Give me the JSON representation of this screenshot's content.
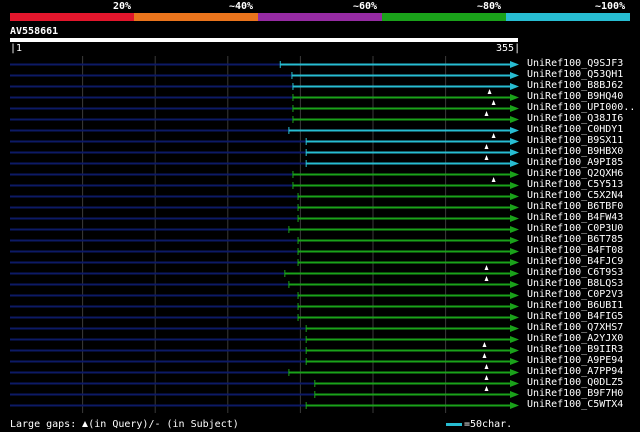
{
  "legend": {
    "labels": [
      "20%",
      "~40%",
      "~60%",
      "~80%",
      "~100%"
    ],
    "colors": [
      "#e2162c",
      "#ea741c",
      "#962ba3",
      "#1aa21a",
      "#27bdd2"
    ]
  },
  "query": {
    "name": "AV558661",
    "start": "1",
    "end": "355"
  },
  "colors": {
    "cyan": "#27bdd2",
    "green": "#1aa21a",
    "navy": "#0d1a66",
    "grid": "#3a3a3a"
  },
  "footer": {
    "text_before": "Large gaps: ",
    "text_after": "(in Query)/- (in Subject)",
    "scale_label": "=50char."
  },
  "hits": [
    {
      "name": "UniRef100_Q9SJF3",
      "start": 0.532,
      "color": "cyan",
      "gap": null
    },
    {
      "name": "UniRef100_Q53QH1",
      "start": 0.555,
      "color": "cyan",
      "gap": null
    },
    {
      "name": "UniRef100_B8BJ62",
      "start": 0.557,
      "color": "cyan",
      "gap": null
    },
    {
      "name": "UniRef100_B9HQ40",
      "start": 0.557,
      "color": "green",
      "gap": 0.944
    },
    {
      "name": "UniRef100_UPI000..",
      "start": 0.557,
      "color": "green",
      "gap": 0.952
    },
    {
      "name": "UniRef100_Q38JI6",
      "start": 0.557,
      "color": "green",
      "gap": 0.938
    },
    {
      "name": "UniRef100_C0HDY1",
      "start": 0.549,
      "color": "cyan",
      "gap": null
    },
    {
      "name": "UniRef100_B9SX11",
      "start": 0.583,
      "color": "cyan",
      "gap": 0.952
    },
    {
      "name": "UniRef100_B9HBX0",
      "start": 0.583,
      "color": "cyan",
      "gap": 0.938
    },
    {
      "name": "UniRef100_A9PI85",
      "start": 0.583,
      "color": "cyan",
      "gap": 0.938
    },
    {
      "name": "UniRef100_Q2QXH6",
      "start": 0.557,
      "color": "green",
      "gap": null
    },
    {
      "name": "UniRef100_C5Y513",
      "start": 0.557,
      "color": "green",
      "gap": 0.952
    },
    {
      "name": "UniRef100_C5X2N4",
      "start": 0.567,
      "color": "green",
      "gap": null
    },
    {
      "name": "UniRef100_B6TBF0",
      "start": 0.567,
      "color": "green",
      "gap": null
    },
    {
      "name": "UniRef100_B4FW43",
      "start": 0.567,
      "color": "green",
      "gap": null
    },
    {
      "name": "UniRef100_C0P3U0",
      "start": 0.549,
      "color": "green",
      "gap": null
    },
    {
      "name": "UniRef100_B6T785",
      "start": 0.567,
      "color": "green",
      "gap": null
    },
    {
      "name": "UniRef100_B4FT08",
      "start": 0.567,
      "color": "green",
      "gap": null
    },
    {
      "name": "UniRef100_B4FJC9",
      "start": 0.567,
      "color": "green",
      "gap": null
    },
    {
      "name": "UniRef100_C6T9S3",
      "start": 0.541,
      "color": "green",
      "gap": 0.938
    },
    {
      "name": "UniRef100_B8LQS3",
      "start": 0.549,
      "color": "green",
      "gap": 0.938
    },
    {
      "name": "UniRef100_C0P2V3",
      "start": 0.567,
      "color": "green",
      "gap": null
    },
    {
      "name": "UniRef100_B6UBI1",
      "start": 0.567,
      "color": "green",
      "gap": null
    },
    {
      "name": "UniRef100_B4FIG5",
      "start": 0.567,
      "color": "green",
      "gap": null
    },
    {
      "name": "UniRef100_Q7XHS7",
      "start": 0.583,
      "color": "green",
      "gap": null
    },
    {
      "name": "UniRef100_A2YJX0",
      "start": 0.583,
      "color": "green",
      "gap": null
    },
    {
      "name": "UniRef100_B9IIR3",
      "start": 0.583,
      "color": "green",
      "gap": 0.934
    },
    {
      "name": "UniRef100_A9PE94",
      "start": 0.583,
      "color": "green",
      "gap": 0.934
    },
    {
      "name": "UniRef100_A7PP94",
      "start": 0.549,
      "color": "green",
      "gap": 0.938
    },
    {
      "name": "UniRef100_Q0DLZ5",
      "start": 0.6,
      "color": "green",
      "gap": 0.938
    },
    {
      "name": "UniRef100_B9F7H0",
      "start": 0.6,
      "color": "green",
      "gap": 0.938
    },
    {
      "name": "UniRef100_C5WTX4",
      "start": 0.583,
      "color": "green",
      "gap": null
    }
  ]
}
